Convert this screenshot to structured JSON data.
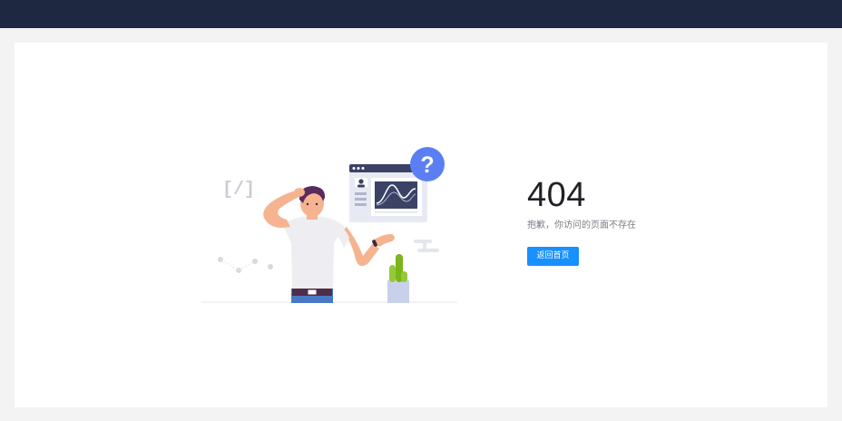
{
  "page": {
    "error_code": "404",
    "message": "抱歉，你访问的页面不存在",
    "back_home_label": "返回首页"
  },
  "colors": {
    "topbar": "#1e2841",
    "primary": "#1890ff",
    "question_badge": "#5b7ff3"
  },
  "illustration": {
    "badge_text": "?",
    "code_symbol": "[/]"
  }
}
